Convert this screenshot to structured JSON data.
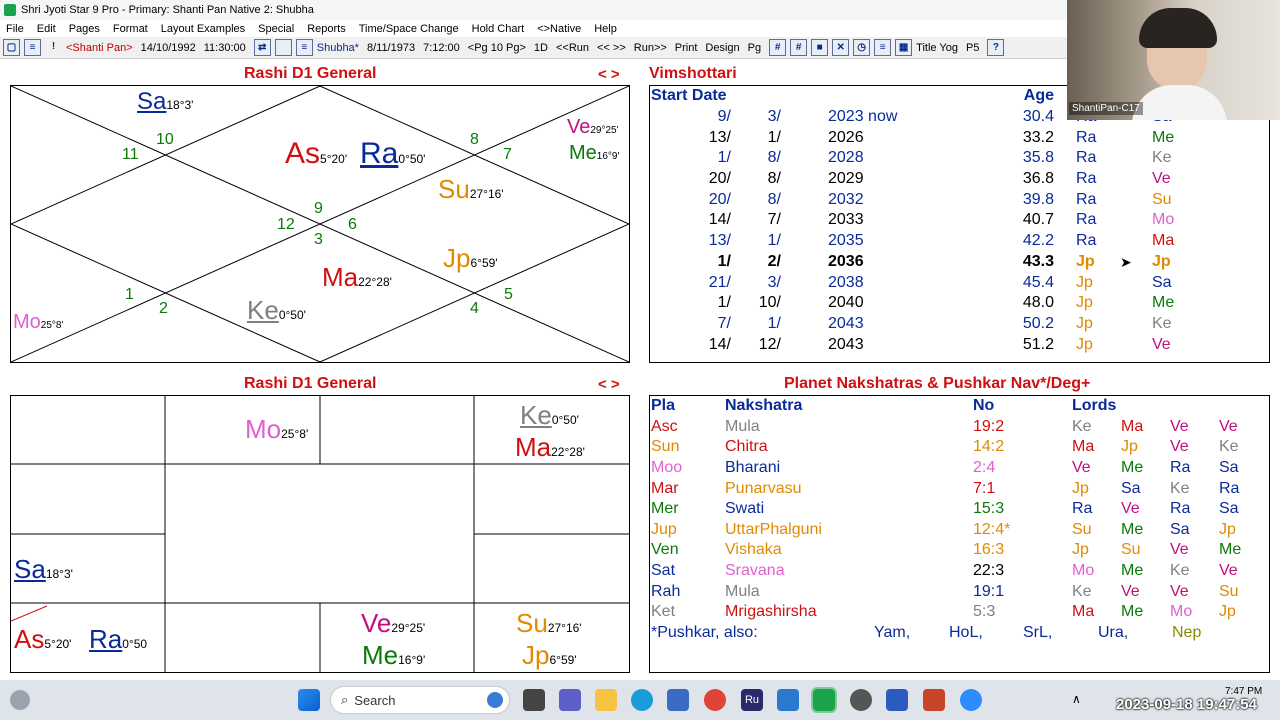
{
  "window": {
    "title": "Shri Jyoti Star 9 Pro - Primary: Shanti Pan     Native 2: Shubha"
  },
  "menu": [
    "File",
    "Edit",
    "Pages",
    "Format",
    "Layout Examples",
    "Special",
    "Reports",
    "Time/Space Change",
    "Hold Chart",
    "<>Native",
    "Help"
  ],
  "toolbar": {
    "native1": "<Shanti Pan>",
    "native1_date": "14/10/1992",
    "native1_time": "11:30:00",
    "native2": "Shubha*",
    "native2_date": "8/11/1973",
    "native2_time": "7:12:00",
    "pg": "<Pg 10 Pg>",
    "d1": "1D",
    "run_back": "<<Run",
    "arrows": "<< >>",
    "run_fwd": "Run>>",
    "print": "Print",
    "design": "Design",
    "pg2": "Pg",
    "title_yog": "Title Yog",
    "p5": "P5"
  },
  "rashi_top": {
    "title": "Rashi D1 General",
    "nav": "< >",
    "planets": [
      {
        "abbr": "Sa",
        "deg": "18°3'"
      },
      {
        "abbr": "As",
        "deg": "5°20'"
      },
      {
        "abbr": "Ra",
        "deg": "0°50'"
      },
      {
        "abbr": "Ve",
        "deg": "29°25'"
      },
      {
        "abbr": "Me",
        "deg": "16°9'"
      },
      {
        "abbr": "Su",
        "deg": "27°16'"
      },
      {
        "abbr": "Jp",
        "deg": "6°59'"
      },
      {
        "abbr": "Ma",
        "deg": "22°28'"
      },
      {
        "abbr": "Ke",
        "deg": "0°50'"
      },
      {
        "abbr": "Mo",
        "deg": "25°8'"
      }
    ],
    "houses": [
      "10",
      "11",
      "8",
      "7",
      "12",
      "9",
      "3",
      "6",
      "1",
      "2",
      "5",
      "4"
    ]
  },
  "rashi_bottom": {
    "title": "Rashi D1 General",
    "nav": "< >",
    "planets": [
      {
        "abbr": "Mo",
        "deg": "25°8'"
      },
      {
        "abbr": "Ke",
        "deg": "0°50'"
      },
      {
        "abbr": "Ma",
        "deg": "22°28'"
      },
      {
        "abbr": "Sa",
        "deg": "18°3'"
      },
      {
        "abbr": "As",
        "deg": "5°20'"
      },
      {
        "abbr": "Ra",
        "deg": "0°50"
      },
      {
        "abbr": "Ve",
        "deg": "29°25'"
      },
      {
        "abbr": "Me",
        "deg": "16°9'"
      },
      {
        "abbr": "Su",
        "deg": "27°16'"
      },
      {
        "abbr": "Jp",
        "deg": "6°59'"
      }
    ]
  },
  "vimshottari": {
    "title": "Vimshottari",
    "headers": {
      "start": "Start Date",
      "age": "Age"
    },
    "rows": [
      {
        "d": "9/",
        "m": "3/",
        "y": "2023 now",
        "age": "30.4",
        "l1": "Ra",
        "l2": "Sa"
      },
      {
        "d": "13/",
        "m": "1/",
        "y": "2026",
        "age": "33.2",
        "l1": "Ra",
        "l2": "Me"
      },
      {
        "d": "1/",
        "m": "8/",
        "y": "2028",
        "age": "35.8",
        "l1": "Ra",
        "l2": "Ke"
      },
      {
        "d": "20/",
        "m": "8/",
        "y": "2029",
        "age": "36.8",
        "l1": "Ra",
        "l2": "Ve"
      },
      {
        "d": "20/",
        "m": "8/",
        "y": "2032",
        "age": "39.8",
        "l1": "Ra",
        "l2": "Su"
      },
      {
        "d": "14/",
        "m": "7/",
        "y": "2033",
        "age": "40.7",
        "l1": "Ra",
        "l2": "Mo"
      },
      {
        "d": "13/",
        "m": "1/",
        "y": "2035",
        "age": "42.2",
        "l1": "Ra",
        "l2": "Ma"
      },
      {
        "d": "1/",
        "m": "2/",
        "y": "2036",
        "age": "43.3",
        "l1": "Jp",
        "l2": "Jp"
      },
      {
        "d": "21/",
        "m": "3/",
        "y": "2038",
        "age": "45.4",
        "l1": "Jp",
        "l2": "Sa"
      },
      {
        "d": "1/",
        "m": "10/",
        "y": "2040",
        "age": "48.0",
        "l1": "Jp",
        "l2": "Me"
      },
      {
        "d": "7/",
        "m": "1/",
        "y": "2043",
        "age": "50.2",
        "l1": "Jp",
        "l2": "Ke"
      },
      {
        "d": "14/",
        "m": "12/",
        "y": "2043",
        "age": "51.2",
        "l1": "Jp",
        "l2": "Ve"
      }
    ]
  },
  "nakshatras": {
    "title": "Planet Nakshatras & Pushkar Nav*/Deg+",
    "headers": {
      "pla": "Pla",
      "nak": "Nakshatra",
      "no": "No",
      "lords": "Lords"
    },
    "rows": [
      {
        "pla": "Asc",
        "nak": "Mula",
        "no": "19:2",
        "lords": [
          "Ke",
          "Ma",
          "Ve",
          "Ve"
        ]
      },
      {
        "pla": "Sun",
        "nak": "Chitra",
        "no": "14:2",
        "lords": [
          "Ma",
          "Jp",
          "Ve",
          "Ke"
        ]
      },
      {
        "pla": "Moo",
        "nak": "Bharani",
        "no": "2:4",
        "lords": [
          "Ve",
          "Me",
          "Ra",
          "Sa"
        ]
      },
      {
        "pla": "Mar",
        "nak": "Punarvasu",
        "no": "7:1",
        "lords": [
          "Jp",
          "Sa",
          "Ke",
          "Ra"
        ]
      },
      {
        "pla": "Mer",
        "nak": "Swati",
        "no": "15:3",
        "lords": [
          "Ra",
          "Ve",
          "Ra",
          "Sa"
        ]
      },
      {
        "pla": "Jup",
        "nak": "UttarPhalguni",
        "no": "12:4*",
        "lords": [
          "Su",
          "Me",
          "Sa",
          "Jp"
        ]
      },
      {
        "pla": "Ven",
        "nak": "Vishaka",
        "no": "16:3",
        "lords": [
          "Jp",
          "Su",
          "Ve",
          "Me"
        ]
      },
      {
        "pla": "Sat",
        "nak": "Sravana",
        "no": "22:3",
        "lords": [
          "Mo",
          "Me",
          "Ke",
          "Ve"
        ]
      },
      {
        "pla": "Rah",
        "nak": "Mula",
        "no": "19:1",
        "lords": [
          "Ke",
          "Ve",
          "Ve",
          "Su"
        ]
      },
      {
        "pla": "Ket",
        "nak": "Mrigashirsha",
        "no": "5:3",
        "lords": [
          "Ma",
          "Me",
          "Mo",
          "Jp"
        ]
      }
    ],
    "footer": {
      "label": "*Pushkar, also:",
      "items": [
        "Yam,",
        "HoL,",
        "SrL,",
        "Ura,",
        "Nep"
      ]
    }
  },
  "video": {
    "name": "ShantiPan-C17"
  },
  "taskbar": {
    "search": "Search",
    "datetime": "2023-09-18 19:47:54",
    "clock": "7:47 PM"
  }
}
